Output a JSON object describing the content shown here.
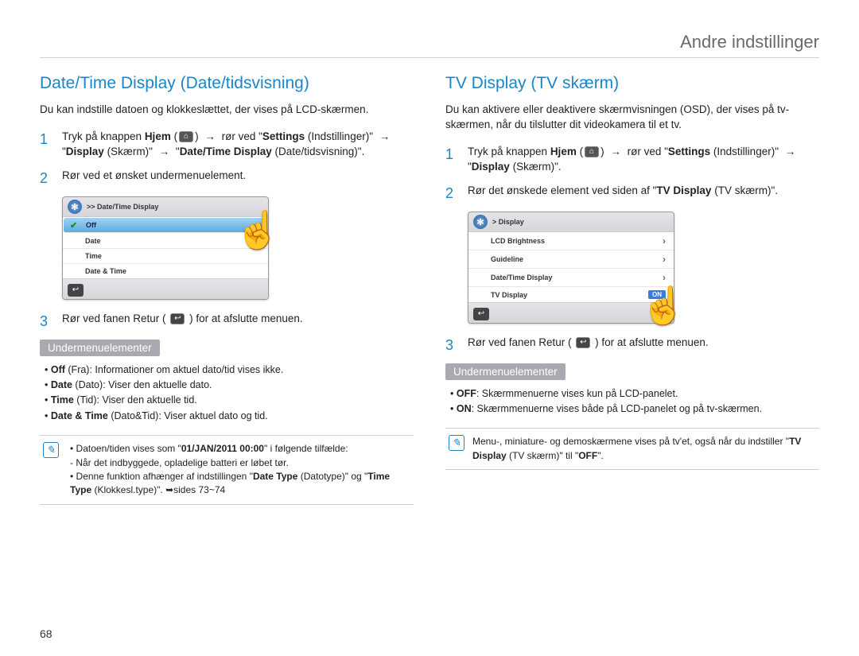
{
  "header_title": "Andre indstillinger",
  "page_number": "68",
  "icons": {
    "home": "⌂",
    "return": "↩",
    "gear": "✻",
    "arrow": "→",
    "hand": "☝"
  },
  "left": {
    "title": "Date/Time Display (Date/tidsvisning)",
    "intro": "Du kan indstille datoen og klokkeslættet, der vises på LCD-skærmen.",
    "step1_a": "Tryk på knappen ",
    "step1_home": "Hjem",
    "step1_b": " rør ved \"",
    "step1_settings": "Settings",
    "step1_c": " (Indstillinger)\" ",
    "step1_d": " \"",
    "step1_display": "Display",
    "step1_e": " (Skærm)\" ",
    "step1_f": " \"",
    "step1_dtd": "Date/Time Display",
    "step1_g": " (Date/tidsvisning)\".",
    "step2": "Rør ved et ønsket undermenuelement.",
    "step3_a": "Rør ved fanen Retur (",
    "step3_b": ") for at afslutte menuen.",
    "mock": {
      "header": ">> Date/Time Display",
      "rows": [
        "Off",
        "Date",
        "Time",
        "Date & Time"
      ]
    },
    "sub_header": "Undermenuelementer",
    "sub_items": [
      {
        "b": "Off",
        "p": " (Fra): Informationer om aktuel dato/tid vises ikke."
      },
      {
        "b": "Date",
        "p": " (Dato): Viser den aktuelle dato."
      },
      {
        "b": "Time",
        "p": " (Tid): Viser den aktuelle tid."
      },
      {
        "b": "Date & Time",
        "p": " (Dato&Tid): Viser aktuel dato og tid."
      }
    ],
    "note": {
      "l1a": "Datoen/tiden vises som \"",
      "l1b": "01/JAN/2011 00:00",
      "l1c": "\" i følgende tilfælde:",
      "l2": "- Når det indbyggede, opladelige batteri er løbet tør.",
      "l3a": "Denne funktion afhænger af indstillingen \"",
      "l3b": "Date Type",
      "l3c": " (Datotype)\" og \"",
      "l3d": "Time Type",
      "l3e": " (Klokkesl.type)\". ",
      "l3f": "sides 73~74"
    }
  },
  "right": {
    "title": "TV Display (TV skærm)",
    "intro": "Du kan aktivere eller deaktivere skærmvisningen (OSD), der vises på tv-skærmen, når du tilslutter dit videokamera til et tv.",
    "step1_a": "Tryk på knappen ",
    "step1_home": "Hjem",
    "step1_b": " rør ved \"",
    "step1_settings": "Settings",
    "step1_c": " (Indstillinger)\" ",
    "step1_d": " \"",
    "step1_display": "Display",
    "step1_e": " (Skærm)\".",
    "step2_a": "Rør det ønskede element ved siden af \"",
    "step2_b": "TV Display",
    "step2_c": " (TV skærm)\".",
    "step3_a": "Rør ved fanen Retur (",
    "step3_b": ") for at afslutte menuen.",
    "mock": {
      "header": "> Display",
      "rows": [
        {
          "label": "LCD Brightness",
          "kind": "chev"
        },
        {
          "label": "Guideline",
          "kind": "chev"
        },
        {
          "label": "Date/Time Display",
          "kind": "chev"
        },
        {
          "label": "TV Display",
          "kind": "toggle",
          "val": "ON"
        }
      ]
    },
    "sub_header": "Undermenuelementer",
    "sub_items": [
      {
        "b": "OFF",
        "p": ": Skærmmenuerne vises kun på LCD-panelet."
      },
      {
        "b": "ON",
        "p": ": Skærmmenuerne vises både på LCD-panelet og på tv-skærmen."
      }
    ],
    "note": {
      "l1a": "Menu-, miniature- og demoskærmene vises på tv'et, også når du indstiller \"",
      "l1b": "TV Display",
      "l1c": " (TV skærm)\" til \"",
      "l1d": "OFF",
      "l1e": "\"."
    }
  }
}
